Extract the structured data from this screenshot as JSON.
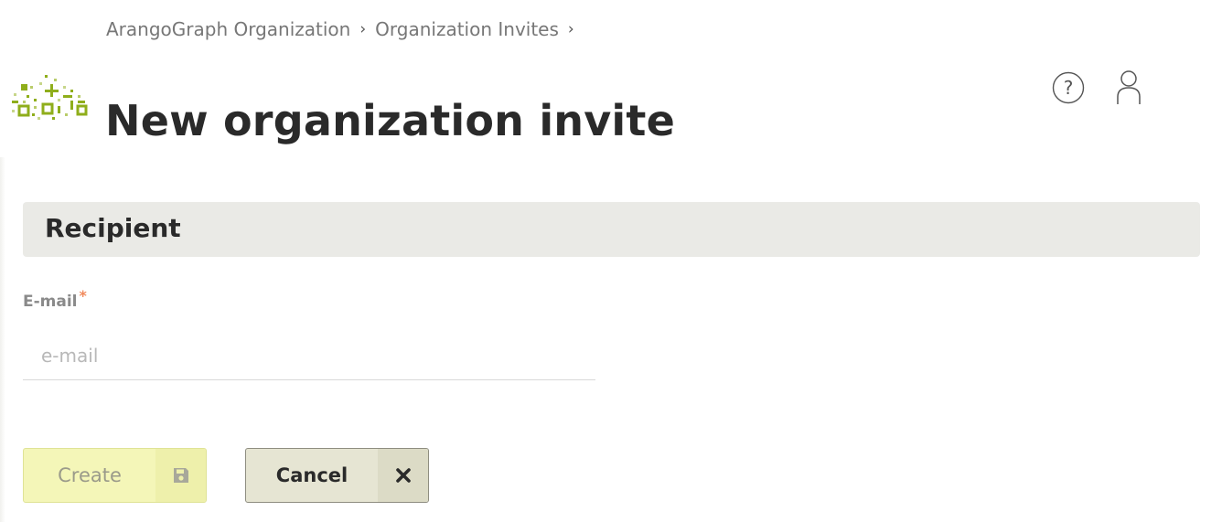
{
  "breadcrumb": {
    "items": [
      "ArangoGraph Organization",
      "Organization Invites"
    ],
    "separator": "›"
  },
  "page": {
    "title": "New organization invite"
  },
  "header_icons": {
    "help": "help-circle-icon",
    "user": "user-icon"
  },
  "section": {
    "title": "Recipient"
  },
  "form": {
    "email_label": "E-mail",
    "required_mark": "*",
    "email_placeholder": "e-mail",
    "email_value": ""
  },
  "actions": {
    "create_label": "Create",
    "create_icon": "save-icon",
    "cancel_label": "Cancel",
    "cancel_icon": "close-icon"
  },
  "colors": {
    "logo_green": "#8fae1b",
    "create_bg": "#f4f6b8",
    "cancel_bg": "#e6e5d3",
    "required": "#f08a5d",
    "section_bg": "#eaeae6"
  }
}
